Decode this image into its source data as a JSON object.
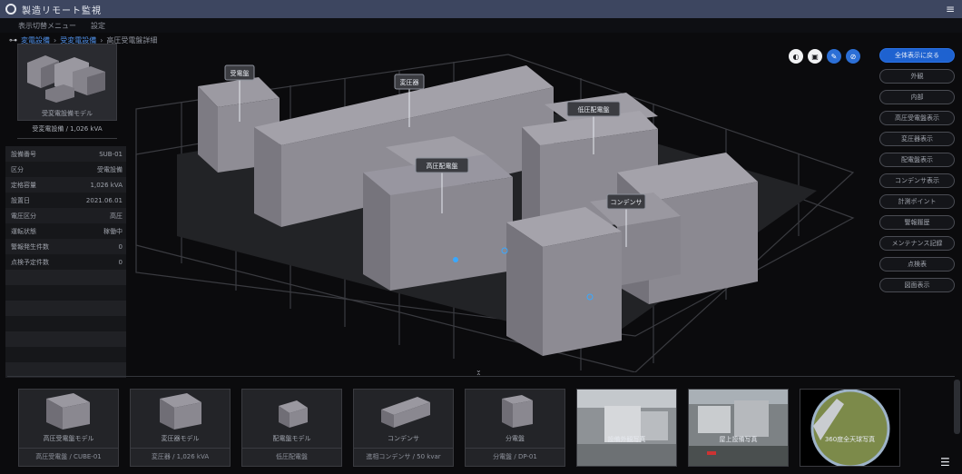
{
  "app": {
    "title": "製造リモート監視"
  },
  "menu": [
    "表示切替メニュー",
    "設定"
  ],
  "breadcrumb": [
    "変電設備",
    "受変電設備",
    "高圧受電盤詳細"
  ],
  "left_panel": {
    "thumb_caption": "受変電設備モデル",
    "thumb_sub": "受変電設備 / 1,026 kVA",
    "properties": [
      {
        "label": "設備番号",
        "value": "SUB-01"
      },
      {
        "label": "区分",
        "value": "受電設備"
      },
      {
        "label": "定格容量",
        "value": "1,026 kVA"
      },
      {
        "label": "設置日",
        "value": "2021.06.01"
      },
      {
        "label": "電圧区分",
        "value": "高圧"
      },
      {
        "label": "運転状態",
        "value": "稼働中"
      },
      {
        "label": "警報発生件数",
        "value": "0"
      },
      {
        "label": "点検予定件数",
        "value": "0"
      }
    ],
    "empty_rows": 7
  },
  "scene": {
    "labels": [
      "受電盤",
      "変圧器",
      "高圧配電盤",
      "低圧配電盤",
      "コンデンサ"
    ]
  },
  "tool_icons": [
    {
      "name": "fill-icon",
      "glyph": "◐",
      "active": false
    },
    {
      "name": "image-icon",
      "glyph": "▣",
      "active": false
    },
    {
      "name": "edit-icon",
      "glyph": "✎",
      "active": true
    },
    {
      "name": "attach-icon",
      "glyph": "⊘",
      "active": true
    }
  ],
  "right_buttons": [
    "全体表示に戻る",
    "外観",
    "内部",
    "高圧受電盤表示",
    "変圧器表示",
    "配電盤表示",
    "コンデンサ表示",
    "計測ポイント",
    "警報履歴",
    "メンテナンス記録",
    "点検表",
    "図面表示"
  ],
  "bottom_cards": [
    {
      "title": "高圧受電盤モデル",
      "sub": "高圧受電盤 / CUBE-01"
    },
    {
      "title": "変圧器モデル",
      "sub": "変圧器 / 1,026 kVA"
    },
    {
      "title": "配電盤モデル",
      "sub": "低圧配電盤"
    },
    {
      "title": "コンデンサ",
      "sub": "進相コンデンサ / 50 kvar"
    },
    {
      "title": "分電盤",
      "sub": "分電盤 / DP-01"
    }
  ],
  "photos": [
    {
      "caption": "設備外観写真"
    },
    {
      "caption": "屋上設備写真"
    },
    {
      "caption": "360度全天球写真"
    }
  ],
  "colors": {
    "accent": "#1e62d0",
    "scene_highlight": "#39a8ff"
  }
}
